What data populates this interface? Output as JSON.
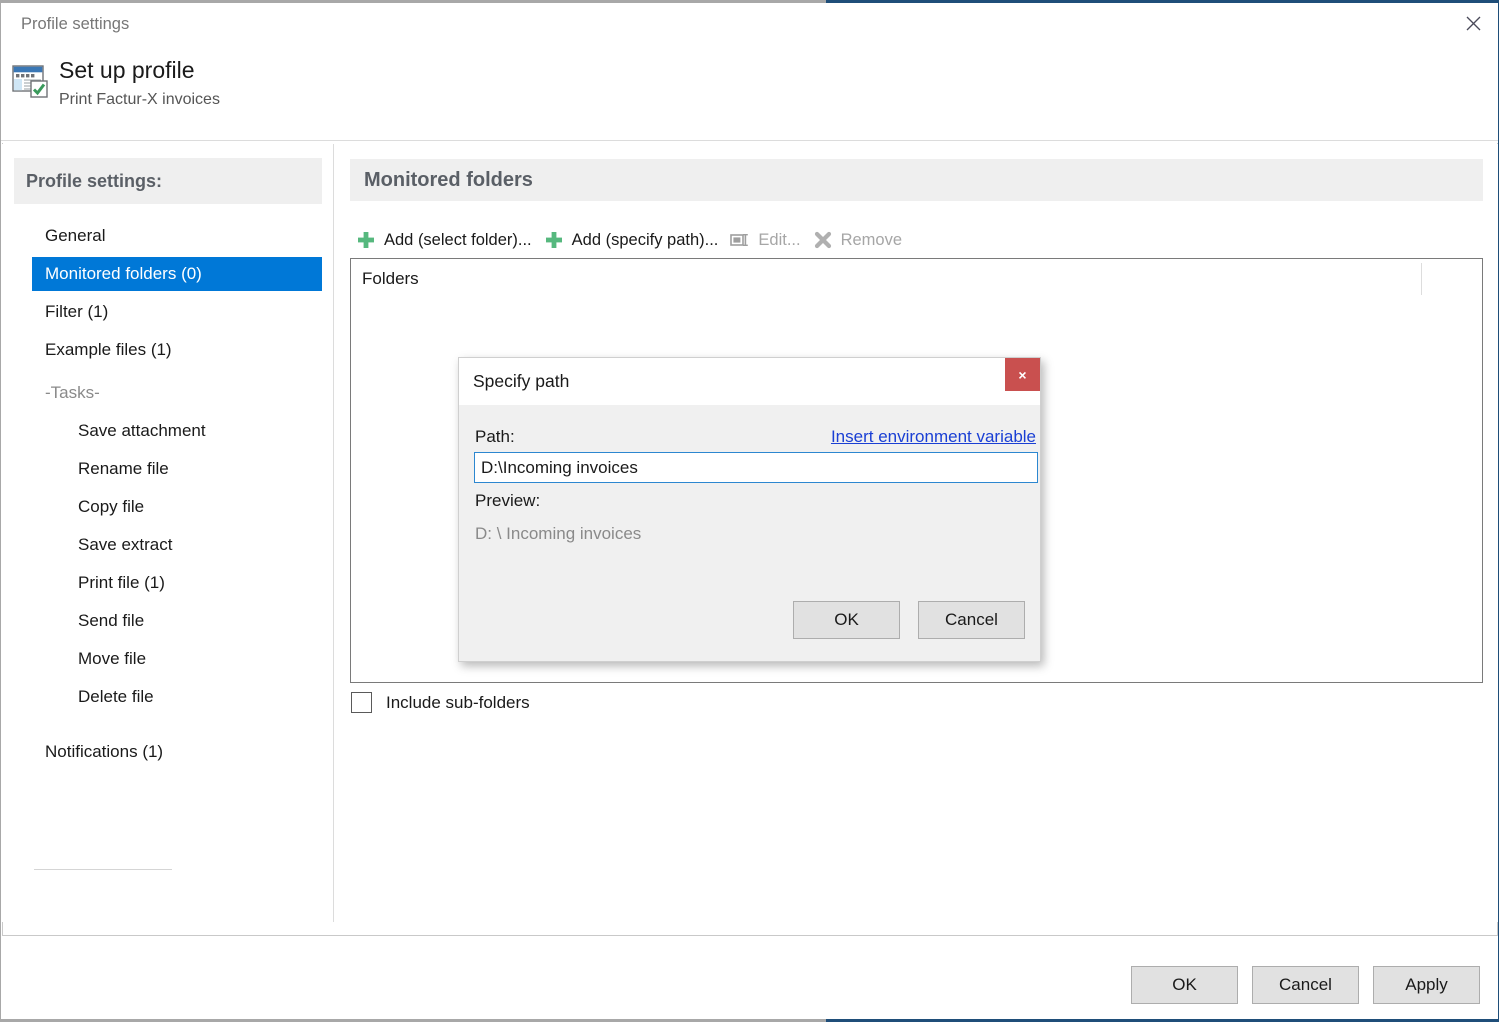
{
  "window": {
    "title": "Profile settings",
    "close_icon": "close-icon",
    "accent_color": "#1f4e79"
  },
  "header": {
    "icon": "profile-window-icon",
    "title": "Set up profile",
    "subtitle": "Print Factur-X invoices"
  },
  "sidebar": {
    "header": "Profile settings:",
    "items": [
      {
        "label": "General",
        "kind": "nav",
        "selected": false
      },
      {
        "label": "Monitored folders (0)",
        "kind": "nav",
        "selected": true
      },
      {
        "label": "Filter (1)",
        "kind": "nav",
        "selected": false
      },
      {
        "label": "Example files (1)",
        "kind": "nav",
        "selected": false
      },
      {
        "label": "-Tasks-",
        "kind": "section",
        "selected": false
      },
      {
        "label": "Save attachment",
        "kind": "task",
        "selected": false
      },
      {
        "label": "Rename file",
        "kind": "task",
        "selected": false
      },
      {
        "label": "Copy file",
        "kind": "task",
        "selected": false
      },
      {
        "label": "Save extract",
        "kind": "task",
        "selected": false
      },
      {
        "label": "Print file (1)",
        "kind": "task",
        "selected": false
      },
      {
        "label": "Send file",
        "kind": "task",
        "selected": false
      },
      {
        "label": "Move file",
        "kind": "task",
        "selected": false
      },
      {
        "label": "Delete file",
        "kind": "task",
        "selected": false
      },
      {
        "label": "Notifications (1)",
        "kind": "nav",
        "selected": false
      }
    ],
    "selected_color": "#0078d7"
  },
  "content": {
    "section_title": "Monitored folders",
    "toolbar": [
      {
        "label": "Add (select folder)...",
        "icon": "plus-icon",
        "disabled": false
      },
      {
        "label": "Add (specify path)...",
        "icon": "plus-icon",
        "disabled": false
      },
      {
        "label": "Edit...",
        "icon": "edit-icon",
        "disabled": true
      },
      {
        "label": "Remove",
        "icon": "remove-x-icon",
        "disabled": true
      }
    ],
    "list": {
      "column_header": "Folders",
      "rows": []
    },
    "include_subfolders": {
      "label": "Include sub-folders",
      "checked": false
    }
  },
  "footer": {
    "buttons": [
      "OK",
      "Cancel",
      "Apply"
    ]
  },
  "dialog": {
    "title": "Specify path",
    "close_label": "×",
    "path_label": "Path:",
    "env_link": "Insert environment variable",
    "path_value": "D:\\Incoming invoices",
    "path_placeholder": "",
    "preview_label": "Preview:",
    "preview_value": "D: \\ Incoming invoices",
    "buttons": [
      "OK",
      "Cancel"
    ]
  }
}
